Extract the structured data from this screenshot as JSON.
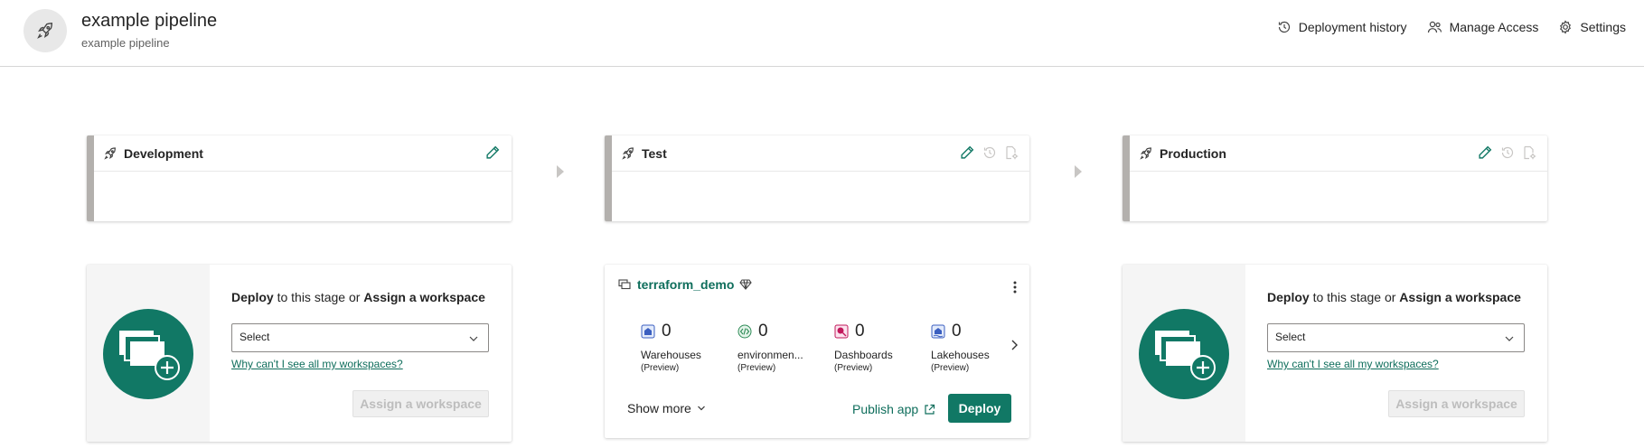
{
  "header": {
    "title": "example pipeline",
    "subtitle": "example pipeline",
    "actions": [
      {
        "label": "Deployment history",
        "icon": "history-icon"
      },
      {
        "label": "Manage Access",
        "icon": "people-icon"
      },
      {
        "label": "Settings",
        "icon": "gear-icon"
      }
    ]
  },
  "stages": [
    {
      "name": "Development"
    },
    {
      "name": "Test"
    },
    {
      "name": "Production"
    }
  ],
  "assign_card": {
    "deploy_word": "Deploy",
    "middle_text": " to this stage or ",
    "assign_word": "Assign a workspace",
    "select_placeholder": "Select",
    "why_link": "Why can't I see all my workspaces?",
    "button_label": "Assign a workspace"
  },
  "workspace": {
    "name": "terraform_demo",
    "items": [
      {
        "count": "0",
        "label": "Warehouses",
        "tag": "(Preview)",
        "icon": "warehouse-icon",
        "color": "#3b5fc0"
      },
      {
        "count": "0",
        "label": "environmen...",
        "tag": "(Preview)",
        "icon": "environment-icon",
        "color": "#2e8b57"
      },
      {
        "count": "0",
        "label": "Dashboards",
        "tag": "(Preview)",
        "icon": "dashboard-icon",
        "color": "#c2185b"
      },
      {
        "count": "0",
        "label": "Lakehouses",
        "tag": "(Preview)",
        "icon": "lakehouse-icon",
        "color": "#3b5fc0"
      }
    ],
    "show_more": "Show more",
    "publish_app": "Publish app",
    "deploy_button": "Deploy"
  },
  "colors": {
    "accent": "#117865",
    "link": "#0f6e5c",
    "stage_bar": "#b3b0ad"
  }
}
